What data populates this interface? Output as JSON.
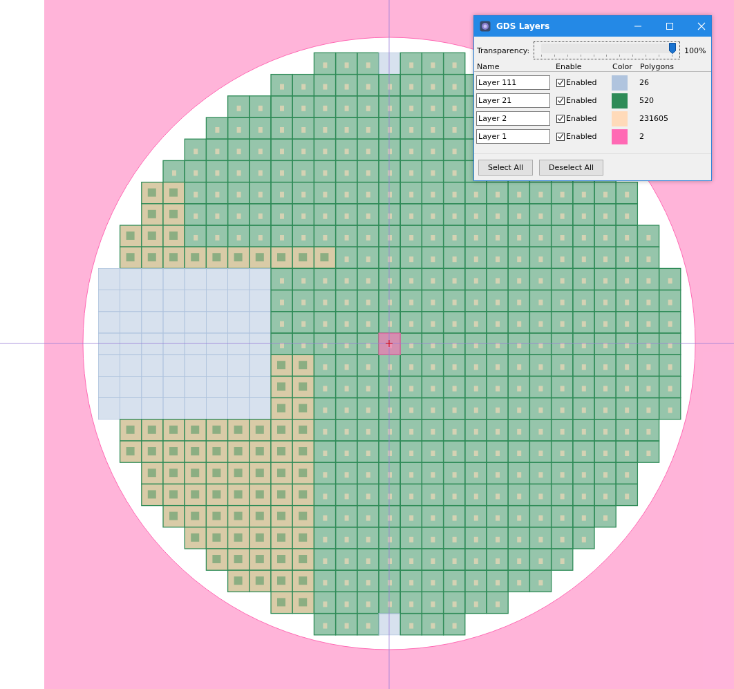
{
  "window": {
    "title": "GDS Layers"
  },
  "transparency": {
    "label": "Transparency:",
    "level": 1.0,
    "reading": "100%"
  },
  "columns": [
    "Name",
    "Enable",
    "Color",
    "Polygons"
  ],
  "layers": [
    {
      "name": "Layer 111",
      "enabled": true,
      "enable_label": "Enabled",
      "color": "#b0c4de",
      "polygons": "26"
    },
    {
      "name": "Layer 21",
      "enabled": true,
      "enable_label": "Enabled",
      "color": "#2e8b57",
      "polygons": "520"
    },
    {
      "name": "Layer 2",
      "enabled": true,
      "enable_label": "Enabled",
      "color": "#ffdab9",
      "polygons": "231605"
    },
    {
      "name": "Layer 1",
      "enabled": true,
      "enable_label": "Enabled",
      "color": "#ff69b4",
      "polygons": "2"
    }
  ],
  "buttons": [
    "Select All",
    "Deselect All"
  ]
}
